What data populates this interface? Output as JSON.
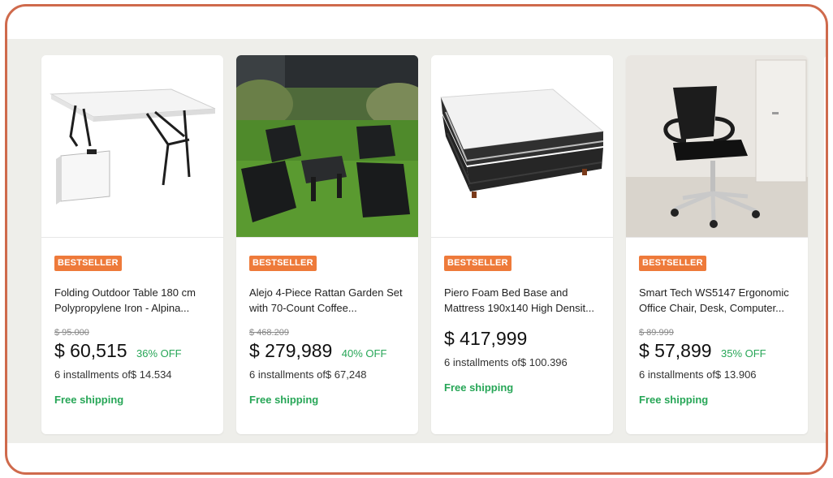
{
  "products": [
    {
      "badge": "BESTSELLER",
      "title": "Folding Outdoor Table 180 cm Polypropylene Iron - Alpina...",
      "old_price": "$ 95.000",
      "price": "$ 60,515",
      "discount": "36% OFF",
      "installments": "6 installments of$ 14.534",
      "shipping": "Free shipping",
      "image": "folding-table-image"
    },
    {
      "badge": "BESTSELLER",
      "title": "Alejo 4-Piece Rattan Garden Set with 70-Count Coffee...",
      "old_price": "$ 468.209",
      "price": "$ 279,989",
      "discount": "40% OFF",
      "installments": "6 installments of$ 67,248",
      "shipping": "Free shipping",
      "image": "rattan-garden-set-image"
    },
    {
      "badge": "BESTSELLER",
      "title": "Piero Foam Bed Base and Mattress 190x140 High Densit...",
      "price": "$ 417,999",
      "installments": "6 installments of$ 100.396",
      "shipping": "Free shipping",
      "image": "bed-mattress-image"
    },
    {
      "badge": "BESTSELLER",
      "title": "Smart Tech WS5147 Ergonomic Office Chair, Desk, Computer...",
      "old_price": "$ 89.999",
      "price": "$ 57,899",
      "discount": "35% OFF",
      "installments": "6 installments of$ 13.906",
      "shipping": "Free shipping",
      "image": "office-chair-image"
    }
  ],
  "colors": {
    "badge": "#ee7a3a",
    "discount": "#27a657",
    "frame_border": "#cf6a4c",
    "band": "#eeeeea"
  }
}
